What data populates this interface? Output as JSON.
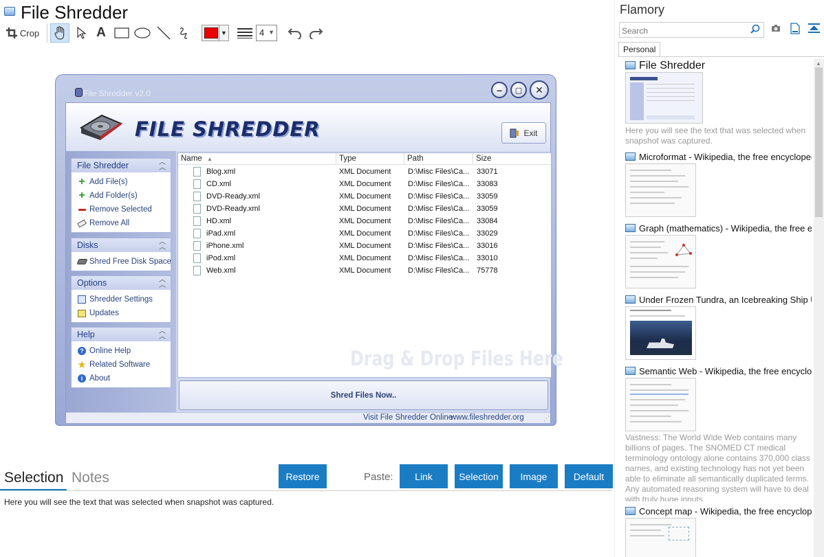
{
  "header": {
    "title": "File Shredder",
    "crop_label": "Crop",
    "stroke_width": "4"
  },
  "colors": {
    "draw_color": "#ee0000",
    "accent": "#1a7dc4"
  },
  "app": {
    "window_title": "File Shredder v2.0",
    "logo_text": "FILE SHREDDER",
    "exit_label": "Exit",
    "groups": [
      {
        "title": "File Shredder",
        "items": [
          "Add File(s)",
          "Add Folder(s)",
          "Remove Selected",
          "Remove All"
        ]
      },
      {
        "title": "Disks",
        "items": [
          "Shred Free Disk Space"
        ]
      },
      {
        "title": "Options",
        "items": [
          "Shredder Settings",
          "Updates"
        ]
      },
      {
        "title": "Help",
        "items": [
          "Online Help",
          "Related Software",
          "About"
        ]
      }
    ],
    "columns": [
      "Name",
      "Type",
      "Path",
      "Size"
    ],
    "files": [
      {
        "name": "Blog.xml",
        "type": "XML Document",
        "path": "D:\\Misc Files\\Ca...",
        "size": "33071"
      },
      {
        "name": "CD.xml",
        "type": "XML Document",
        "path": "D:\\Misc Files\\Ca...",
        "size": "33083"
      },
      {
        "name": "DVD-Ready.xml",
        "type": "XML Document",
        "path": "D:\\Misc Files\\Ca...",
        "size": "33059"
      },
      {
        "name": "DVD-Ready.xml",
        "type": "XML Document",
        "path": "D:\\Misc Files\\Ca...",
        "size": "33059"
      },
      {
        "name": "HD.xml",
        "type": "XML Document",
        "path": "D:\\Misc Files\\Ca...",
        "size": "33084"
      },
      {
        "name": "iPad.xml",
        "type": "XML Document",
        "path": "D:\\Misc Files\\Ca...",
        "size": "33029"
      },
      {
        "name": "iPhone.xml",
        "type": "XML Document",
        "path": "D:\\Misc Files\\Ca...",
        "size": "33016"
      },
      {
        "name": "iPod.xml",
        "type": "XML Document",
        "path": "D:\\Misc Files\\Ca...",
        "size": "33010"
      },
      {
        "name": "Web.xml",
        "type": "XML Document",
        "path": "D:\\Misc Files\\Ca...",
        "size": "75778"
      }
    ],
    "drop_hint": "Drag & Drop Files Here",
    "shred_button": "Shred Files Now..",
    "status_left": "Visit File Shredder Online",
    "status_url": "www.fileshredder.org"
  },
  "bottom": {
    "tabs": [
      "Selection",
      "Notes"
    ],
    "restore": "Restore",
    "paste_label": "Paste:",
    "paste_buttons": [
      "Link",
      "Selection",
      "Image",
      "Default"
    ],
    "selection_text": "Here you will see the text that was selected when snapshot was captured."
  },
  "sidebar": {
    "title": "Flamory",
    "search_placeholder": "Search",
    "tab": "Personal",
    "snapshots": [
      {
        "title": "File Shredder",
        "desc": "Here you will see the text that was selected when snapshot was captured."
      },
      {
        "title": "Microformat - Wikipedia, the free encyclopedia"
      },
      {
        "title": "Graph (mathematics) - Wikipedia, the free ency"
      },
      {
        "title": "Under Frozen Tundra, an Icebreaking Ship Unco"
      },
      {
        "title": "Semantic Web - Wikipedia, the free encycloped",
        "desc": "Vastness: The World Wide Web contains many billions of pages. The SNOMED CT medical terminology ontology alone contains 370,000 class names, and existing technology has not yet been able to eliminate all semantically duplicated terms. Any automated reasoning system will have to deal with truly huge inputs."
      },
      {
        "title": "Concept map - Wikipedia, the free encyclopedi"
      }
    ]
  }
}
